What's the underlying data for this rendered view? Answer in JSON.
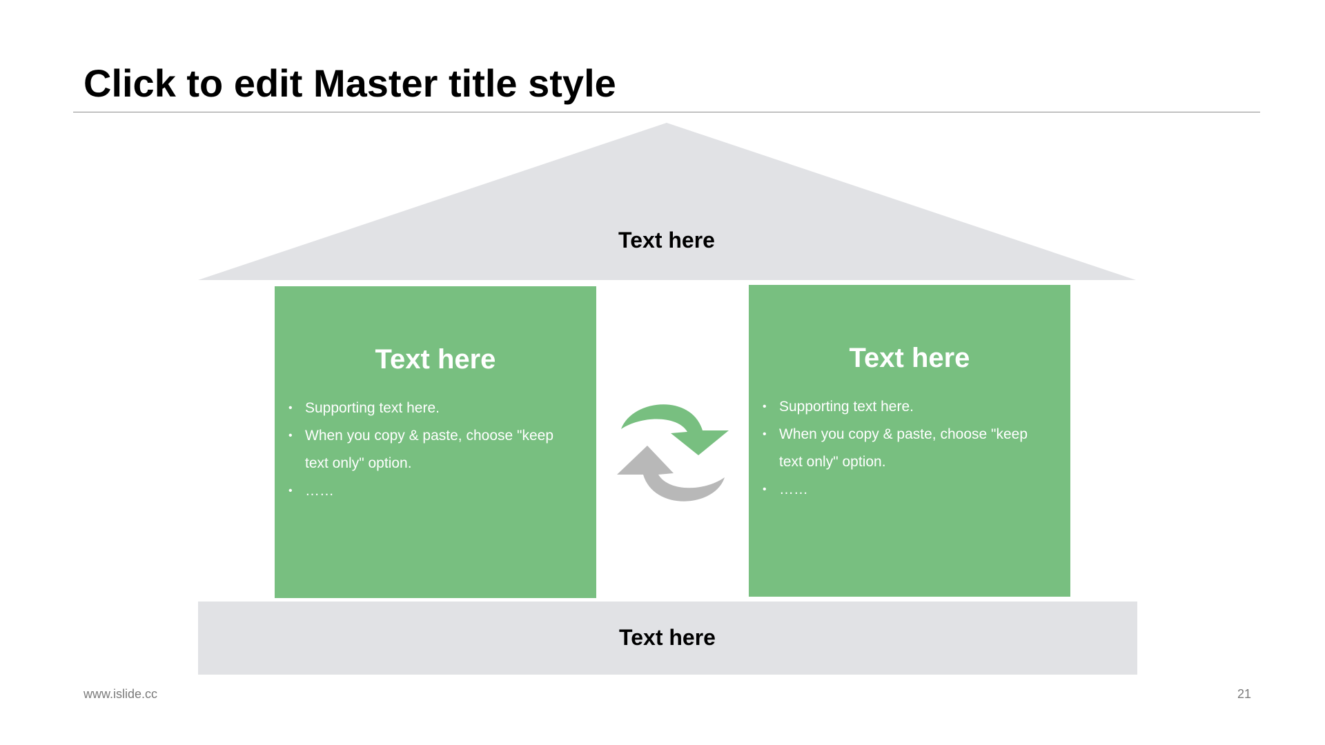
{
  "slide": {
    "title": "Click to edit Master title style",
    "roof": {
      "label": "Text here"
    },
    "left_panel": {
      "heading": "Text here",
      "bullets": [
        "Supporting text here.",
        "When you copy & paste, choose \"keep text only\" option.",
        "……"
      ]
    },
    "right_panel": {
      "heading": "Text here",
      "bullets": [
        "Supporting text here.",
        "When you copy & paste, choose \"keep text only\" option.",
        "……"
      ]
    },
    "base": {
      "label": "Text here"
    },
    "footer": {
      "url": "www.islide.cc",
      "page_number": "21"
    },
    "center_icon": "cycle-arrows-icon"
  },
  "colors": {
    "panel_green": "#78bf80",
    "roof_grey": "#e1e2e5",
    "arrow_green": "#78bf80",
    "arrow_grey": "#b8b8b8"
  }
}
